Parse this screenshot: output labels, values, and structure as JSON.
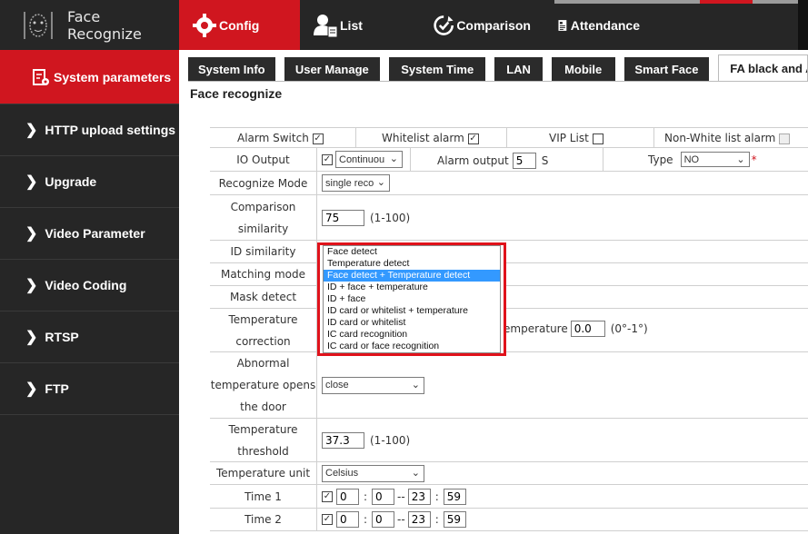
{
  "app": {
    "title": "Face Recognize"
  },
  "topnav": [
    {
      "label": "Config",
      "icon": "gear-icon"
    },
    {
      "label": "List",
      "icon": "user-list-icon"
    },
    {
      "label": "Comparison",
      "icon": "comparison-icon"
    },
    {
      "label": "Attendance",
      "icon": "attendance-icon"
    }
  ],
  "sidebar": [
    {
      "label": "System parameters"
    },
    {
      "label": "HTTP upload settings"
    },
    {
      "label": "Upgrade"
    },
    {
      "label": "Video Parameter"
    },
    {
      "label": "Video Coding"
    },
    {
      "label": "RTSP"
    },
    {
      "label": "FTP"
    }
  ],
  "tabs": [
    "System Info",
    "User Manage",
    "System Time",
    "LAN",
    "Mobile",
    "Smart Face",
    "FA black and A"
  ],
  "section_title": "Face recognize",
  "form": {
    "alarm_switch": "Alarm Switch",
    "whitelist_alarm": "Whitelist alarm",
    "vip_list": "VIP List",
    "non_white_alarm": "Non-White list alarm",
    "io_output": {
      "label": "IO Output",
      "value": "Continuou"
    },
    "alarm_output": {
      "label": "Alarm output",
      "value": "5",
      "unit": "S"
    },
    "type": {
      "label": "Type",
      "value": "NO",
      "required_mark": "*"
    },
    "recognize_mode": {
      "label": "Recognize Mode",
      "value": "single reco"
    },
    "comparison_similarity": {
      "label1": "Comparison",
      "label2": "similarity",
      "value": "75",
      "hint": "(1-100)"
    },
    "id_similarity": {
      "label": "ID similarity"
    },
    "matching_mode": {
      "label": "Matching mode"
    },
    "mask_detect": {
      "label": "Mask detect"
    },
    "temperature_correction": {
      "label1": "Temperature",
      "label2": "correction",
      "partial_label": "emperature",
      "value": "0.0",
      "hint": "(0°-1°)"
    },
    "abnormal_temp": {
      "label1": "Abnormal",
      "label2": "temperature opens",
      "label3": "the door",
      "value": "close"
    },
    "temperature_threshold": {
      "label1": "Temperature",
      "label2": "threshold",
      "value": "37.3",
      "hint": "(1-100)"
    },
    "temperature_unit": {
      "label": "Temperature unit",
      "value": "Celsius"
    },
    "time1": {
      "label": "Time 1",
      "h1": "0",
      "m1": "0",
      "h2": "23",
      "m2": "59"
    },
    "time2": {
      "label": "Time 2",
      "h1": "0",
      "m1": "0",
      "h2": "23",
      "m2": "59"
    },
    "time_sep": ":",
    "time_dash": "--"
  },
  "dropdown_options": [
    "Face detect",
    "Temperature detect",
    "Face detect + Temperature detect",
    "ID + face + temperature",
    "ID + face",
    "ID card or whitelist + temperature",
    "ID card or whitelist",
    "IC card recognition",
    "IC card or face recognition"
  ],
  "dropdown_selected": "Face detect + Temperature detect",
  "colors": {
    "accent": "#d0161f",
    "dark": "#262626",
    "highlight": "#3399ff"
  }
}
